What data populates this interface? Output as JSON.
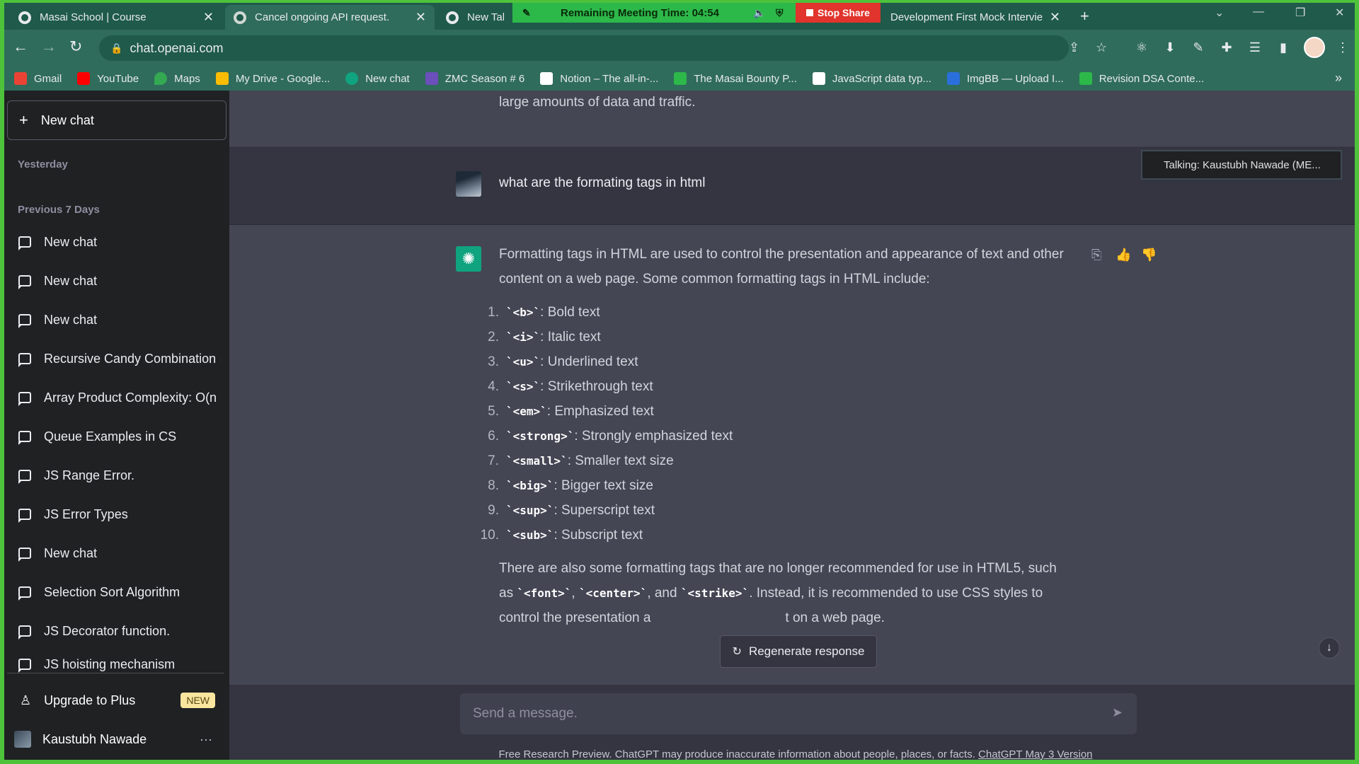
{
  "tabs": [
    {
      "title": "Masai School | Course"
    },
    {
      "title": "Cancel ongoing API request."
    },
    {
      "title": "New Tab"
    },
    {
      "title": "Development First Mock Intervie"
    }
  ],
  "meeting": {
    "label": "Remaining Meeting Time: 04:54",
    "stop_label": "Stop Share"
  },
  "address": {
    "url": "chat.openai.com"
  },
  "bookmarks": [
    {
      "label": "Gmail",
      "color": "#ea4335"
    },
    {
      "label": "YouTube",
      "color": "#ff0000"
    },
    {
      "label": "Maps",
      "color": "#34a853"
    },
    {
      "label": "My Drive - Google...",
      "color": "#fbbc04"
    },
    {
      "label": "New chat",
      "color": "#10a37f"
    },
    {
      "label": "ZMC Season # 6",
      "color": "#6b4fbb"
    },
    {
      "label": "Notion – The all-in-...",
      "color": "#ffffff"
    },
    {
      "label": "The Masai Bounty P...",
      "color": "#2db84a"
    },
    {
      "label": "JavaScript data typ...",
      "color": "#ffffff"
    },
    {
      "label": "ImgBB — Upload I...",
      "color": "#2a6fdb"
    },
    {
      "label": "Revision DSA Conte...",
      "color": "#2db84a"
    }
  ],
  "sidebar": {
    "new_chat": "New chat",
    "section_yesterday": "Yesterday",
    "section_prev7": "Previous 7 Days",
    "items": [
      {
        "label": "New chat"
      },
      {
        "label": "New chat"
      },
      {
        "label": "New chat"
      },
      {
        "label": "Recursive Candy Combination"
      },
      {
        "label": "Array Product Complexity: O(n"
      },
      {
        "label": "Queue Examples in CS"
      },
      {
        "label": "JS Range Error."
      },
      {
        "label": "JS Error Types"
      },
      {
        "label": "New chat"
      },
      {
        "label": "Selection Sort Algorithm"
      },
      {
        "label": "JS Decorator function."
      },
      {
        "label": "JS hoisting mechanism"
      }
    ],
    "upgrade": "Upgrade to Plus",
    "upgrade_badge": "NEW",
    "user_name": "Kaustubh Nawade",
    "more": "···"
  },
  "conversation": {
    "prev_tail": "large amounts of data and traffic.",
    "user_message": "what are the formating tags in html",
    "talking": "Talking: Kaustubh Nawade (ME...",
    "answer_intro": "Formatting tags in HTML are used to control the presentation and appearance of text and other content on a web page. Some common formatting tags in HTML include:",
    "list": [
      {
        "num": "1.",
        "tag": "`<b>`",
        "desc": ": Bold text"
      },
      {
        "num": "2.",
        "tag": "`<i>`",
        "desc": ": Italic text"
      },
      {
        "num": "3.",
        "tag": "`<u>`",
        "desc": ": Underlined text"
      },
      {
        "num": "4.",
        "tag": "`<s>`",
        "desc": ": Strikethrough text"
      },
      {
        "num": "5.",
        "tag": "`<em>`",
        "desc": ": Emphasized text"
      },
      {
        "num": "6.",
        "tag": "`<strong>`",
        "desc": ": Strongly emphasized text"
      },
      {
        "num": "7.",
        "tag": "`<small>`",
        "desc": ": Smaller text size"
      },
      {
        "num": "8.",
        "tag": "`<big>`",
        "desc": ": Bigger text size"
      },
      {
        "num": "9.",
        "tag": "`<sup>`",
        "desc": ": Superscript text"
      },
      {
        "num": "10.",
        "tag": "`<sub>`",
        "desc": ": Subscript text"
      }
    ],
    "outro_1": "There are also some formatting tags that are no longer recommended for use in HTML5, such as ",
    "outro_tag1": "`<font>`",
    "outro_sep1": ", ",
    "outro_tag2": "`<center>`",
    "outro_sep2": ", and ",
    "outro_tag3": "`<strike>`",
    "outro_2": ". Instead, it is recommended to use CSS styles to control the presentation a",
    "outro_3": "t on a web page."
  },
  "composer": {
    "regenerate": "Regenerate response",
    "placeholder": "Send a message.",
    "disclaimer": "Free Research Preview. ChatGPT may produce inaccurate information about people, places, or facts. ",
    "version_link": "ChatGPT May 3 Version"
  }
}
